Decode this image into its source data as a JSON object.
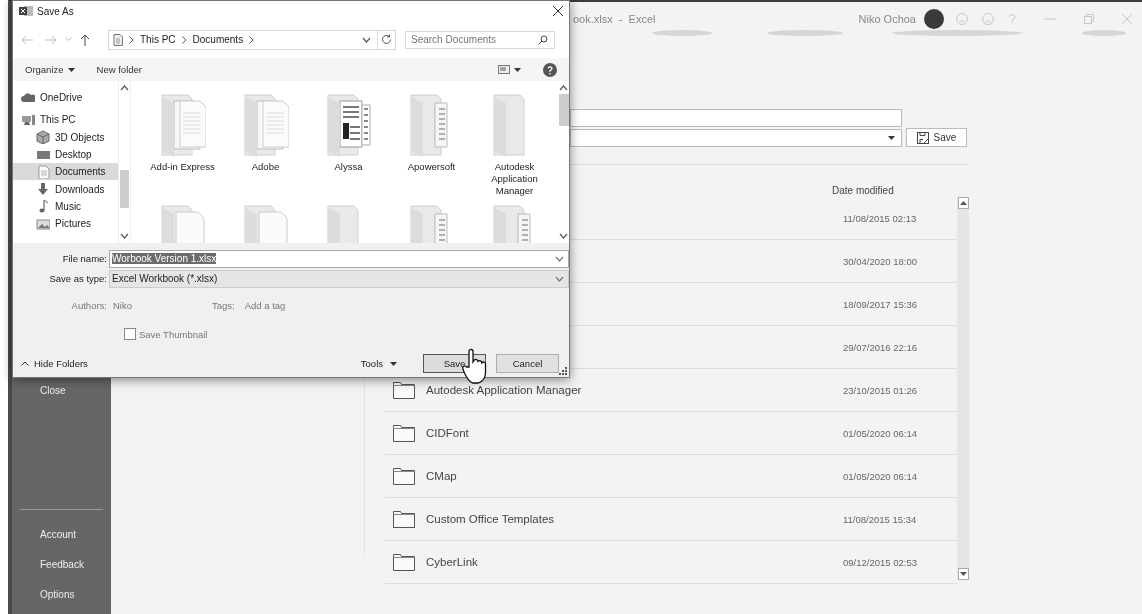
{
  "excel": {
    "title": "ook.xlsx  -  Excel",
    "user": "Niko Ochoa",
    "sidebar": [
      {
        "label": "Close",
        "kind": "top"
      },
      {
        "label": "Account",
        "kind": "bottom"
      },
      {
        "label": "Feedback",
        "kind": "bottom"
      },
      {
        "label": "Options",
        "kind": "bottom"
      }
    ],
    "save_button": "Save",
    "column_header": "Date modified",
    "rows": [
      {
        "date": "11/08/2015 02:13"
      },
      {
        "date": "30/04/2020 18:00"
      },
      {
        "date": "18/09/2017 15:36"
      },
      {
        "date": "29/07/2016 22:16"
      },
      {
        "name": "Autodesk Application Manager",
        "date": "23/10/2015 01:26"
      },
      {
        "name": "CIDFont",
        "date": "01/05/2020 06:14"
      },
      {
        "name": "CMap",
        "date": "01/05/2020 06:14"
      },
      {
        "name": "Custom Office Templates",
        "date": "11/08/2015 15:34"
      },
      {
        "name": "CyberLink",
        "date": "09/12/2015 02:53"
      }
    ]
  },
  "dialog": {
    "title": "Save As",
    "breadcrumb": [
      "This PC",
      "Documents"
    ],
    "search": {
      "placeholder": "Search Documents"
    },
    "toolbar": [
      {
        "label": "Organize",
        "kind": "menu"
      },
      {
        "label": "New folder",
        "kind": "plain"
      }
    ],
    "nav": [
      {
        "label": "OneDrive",
        "kind": "cloud",
        "selected": false
      },
      {
        "label": "This PC",
        "kind": "computer",
        "selected": false,
        "children": [
          {
            "label": "3D Objects",
            "kind": "cube",
            "selected": false
          },
          {
            "label": "Desktop",
            "kind": "desktop",
            "selected": false
          },
          {
            "label": "Documents",
            "kind": "document",
            "selected": true
          },
          {
            "label": "Downloads",
            "kind": "download",
            "selected": false
          },
          {
            "label": "Music",
            "kind": "music",
            "selected": false
          },
          {
            "label": "Pictures",
            "kind": "picture",
            "selected": false
          }
        ]
      }
    ],
    "folders": [
      {
        "label": "Add-in Express",
        "kind": "docs"
      },
      {
        "label": "Adobe",
        "kind": "docs"
      },
      {
        "label": "Alyssa",
        "kind": "dark"
      },
      {
        "label": "Apowersoft",
        "kind": "strip"
      },
      {
        "label": "Autodesk Application Manager",
        "kind": "plain"
      },
      {
        "kind": "blank"
      },
      {
        "kind": "blank"
      },
      {
        "kind": "plain"
      },
      {
        "kind": "strip"
      },
      {
        "kind": "strip"
      }
    ],
    "file_name": {
      "label": "File name:",
      "value": "Worbook Version 1.xlsx",
      "text_selected": true
    },
    "save_as_type": {
      "label": "Save as type:",
      "value": "Excel Workbook (*.xlsx)"
    },
    "authors": {
      "label": "Authors:",
      "value": "Niko"
    },
    "tags": {
      "label": "Tags:",
      "placeholder": "Add a tag"
    },
    "save_thumbnail": {
      "label": "Save Thumbnail",
      "checked": false
    },
    "hide_folders": "Hide Folders",
    "tools": "Tools",
    "buttons": [
      {
        "label": "Save",
        "default": true
      },
      {
        "label": "Cancel",
        "default": false
      }
    ]
  }
}
